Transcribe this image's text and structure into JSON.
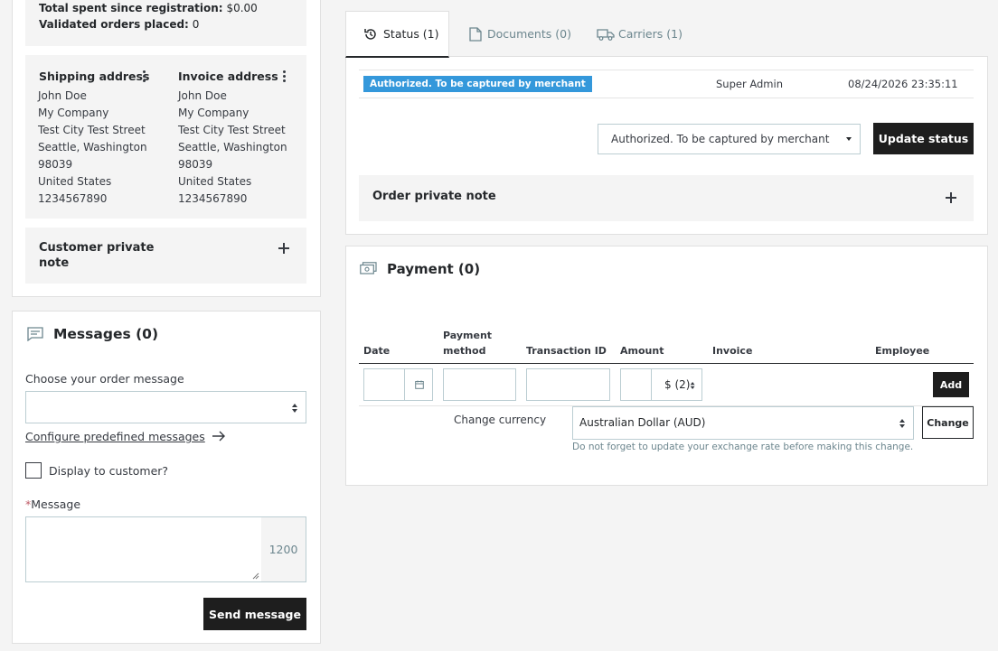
{
  "customer": {
    "total_spent_label": "Total spent since registration:",
    "total_spent_value": "$0.00",
    "validated_orders_label": "Validated orders placed:",
    "validated_orders_value": "0"
  },
  "shipping_address": {
    "title": "Shipping address",
    "lines": [
      "John Doe",
      "My Company",
      "Test City Test Street",
      "Seattle, Washington",
      "98039",
      "United States",
      "1234567890"
    ]
  },
  "invoice_address": {
    "title": "Invoice address",
    "lines": [
      "John Doe",
      "My Company",
      "Test City Test Street",
      "Seattle, Washington",
      "98039",
      "United States",
      "1234567890"
    ]
  },
  "customer_note": {
    "title_line1": "Customer private",
    "title_line2": "note"
  },
  "messages": {
    "title": "Messages (0)",
    "choose_label": "Choose your order message",
    "choose_value": "",
    "configure_link": "Configure predefined messages",
    "display_label": "Display to customer?",
    "required_mark": "*",
    "message_label": "Message",
    "message_value": "",
    "counter": "1200",
    "send_button": "Send message"
  },
  "tabs": [
    {
      "label": "Status (1)",
      "icon": "history-icon"
    },
    {
      "label": "Documents (0)",
      "icon": "document-icon"
    },
    {
      "label": "Carriers (1)",
      "icon": "truck-icon"
    }
  ],
  "status": {
    "badge": "Authorized. To be captured by merchant",
    "badge_color": "#25b9d7",
    "employee": "Super Admin",
    "date": "08/24/2026 23:35:11",
    "select_value": "Authorized. To be captured by merchant",
    "update_button": "Update status"
  },
  "order_note": {
    "title": "Order private note"
  },
  "payment": {
    "title": "Payment (0)",
    "columns": [
      "Date",
      "Payment method",
      "Transaction ID",
      "Amount",
      "Invoice",
      "Employee"
    ],
    "payment_method_line1": "Payment",
    "payment_method_line2": "method",
    "currency_select": "$ (2)",
    "add_button": "Add",
    "change_currency_label": "Change currency",
    "currency_value": "Australian Dollar (AUD)",
    "change_button": "Change",
    "hint": "Do not forget to update your exchange rate before making this change."
  }
}
